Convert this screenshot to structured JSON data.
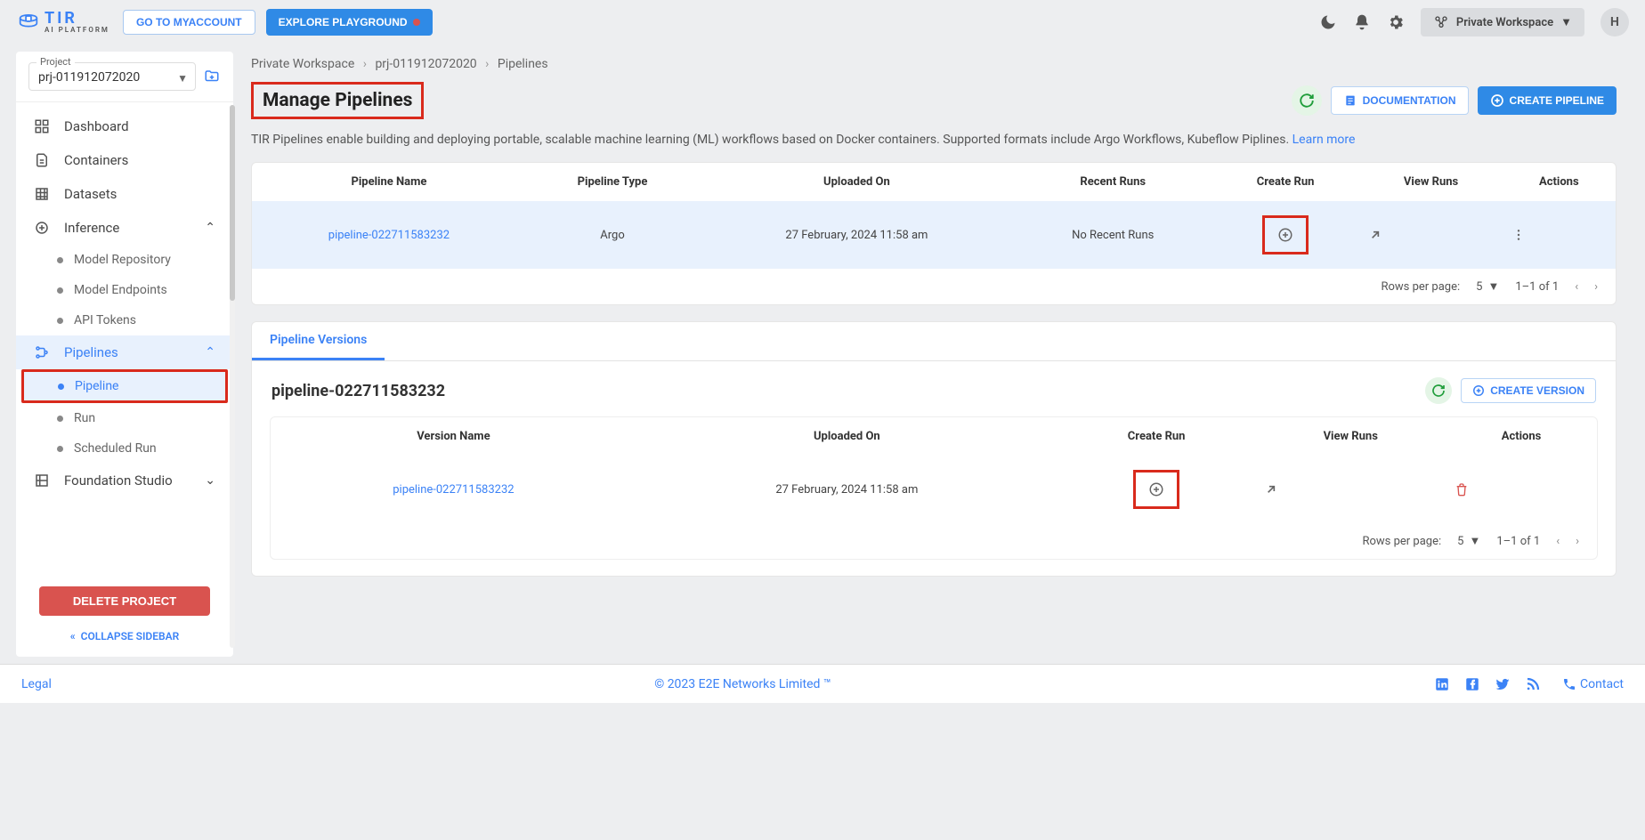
{
  "topbar": {
    "logo_main": "TIR",
    "logo_sub": "AI PLATFORM",
    "btn_myaccount": "GO TO MYACCOUNT",
    "btn_explore": "EXPLORE PLAYGROUND",
    "workspace_label": "Private Workspace",
    "avatar_initial": "H"
  },
  "sidebar": {
    "project_label": "Project",
    "project_value": "prj-011912072020",
    "nav": {
      "dashboard": "Dashboard",
      "containers": "Containers",
      "datasets": "Datasets",
      "inference": "Inference",
      "model_repo": "Model Repository",
      "model_endpoints": "Model Endpoints",
      "api_tokens": "API Tokens",
      "pipelines": "Pipelines",
      "pipeline": "Pipeline",
      "run": "Run",
      "scheduled_run": "Scheduled Run",
      "foundation": "Foundation Studio"
    },
    "delete": "DELETE PROJECT",
    "collapse": "COLLAPSE SIDEBAR"
  },
  "breadcrumb": {
    "a": "Private Workspace",
    "b": "prj-011912072020",
    "c": "Pipelines"
  },
  "title": "Manage Pipelines",
  "actions": {
    "documentation": "DOCUMENTATION",
    "create_pipeline": "CREATE PIPELINE",
    "create_version": "CREATE VERSION"
  },
  "desc_text": "TIR Pipelines enable building and deploying portable, scalable machine learning (ML) workflows based on Docker containers. Supported formats include Argo Workflows, Kubeflow Piplines. ",
  "desc_link": "Learn more",
  "table1": {
    "headers": {
      "name": "Pipeline Name",
      "type": "Pipeline Type",
      "uploaded": "Uploaded On",
      "recent": "Recent Runs",
      "create": "Create Run",
      "view": "View Runs",
      "actions": "Actions"
    },
    "row": {
      "name": "pipeline-022711583232",
      "type": "Argo",
      "uploaded": "27 February, 2024 11:58 am",
      "recent": "No Recent Runs"
    }
  },
  "pagination": {
    "rows_label": "Rows per page:",
    "rows_value": "5",
    "range": "1–1 of 1"
  },
  "tabs": {
    "versions": "Pipeline Versions"
  },
  "versions_title": "pipeline-022711583232",
  "table2": {
    "headers": {
      "name": "Version Name",
      "uploaded": "Uploaded On",
      "create": "Create Run",
      "view": "View Runs",
      "actions": "Actions"
    },
    "row": {
      "name": "pipeline-022711583232",
      "uploaded": "27 February, 2024 11:58 am"
    }
  },
  "footer": {
    "legal": "Legal",
    "copyright": "© 2023 E2E Networks Limited ™",
    "contact": "Contact"
  }
}
